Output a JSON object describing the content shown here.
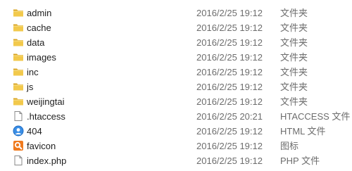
{
  "files": [
    {
      "name": "admin",
      "modified": "2016/2/25 19:12",
      "type": "文件夹",
      "icon": "folder-icon"
    },
    {
      "name": "cache",
      "modified": "2016/2/25 19:12",
      "type": "文件夹",
      "icon": "folder-icon"
    },
    {
      "name": "data",
      "modified": "2016/2/25 19:12",
      "type": "文件夹",
      "icon": "folder-icon"
    },
    {
      "name": "images",
      "modified": "2016/2/25 19:12",
      "type": "文件夹",
      "icon": "folder-icon"
    },
    {
      "name": "inc",
      "modified": "2016/2/25 19:12",
      "type": "文件夹",
      "icon": "folder-icon"
    },
    {
      "name": "js",
      "modified": "2016/2/25 19:12",
      "type": "文件夹",
      "icon": "folder-icon"
    },
    {
      "name": "weijingtai",
      "modified": "2016/2/25 19:12",
      "type": "文件夹",
      "icon": "folder-icon"
    },
    {
      "name": ".htaccess",
      "modified": "2016/2/25 20:21",
      "type": "HTACCESS 文件",
      "icon": "blank-file-icon"
    },
    {
      "name": "404",
      "modified": "2016/2/25 19:12",
      "type": "HTML 文件",
      "icon": "html-file-icon"
    },
    {
      "name": "favicon",
      "modified": "2016/2/25 19:12",
      "type": "图标",
      "icon": "image-file-icon"
    },
    {
      "name": "index.php",
      "modified": "2016/2/25 19:12",
      "type": "PHP 文件",
      "icon": "blank-file-icon"
    }
  ],
  "colors": {
    "folder": "#e8b838",
    "name_text": "#1e1e1e",
    "meta_text": "#6d6d6d",
    "html_icon": "#3a8ee6",
    "favicon_icon": "#f07a1e"
  }
}
